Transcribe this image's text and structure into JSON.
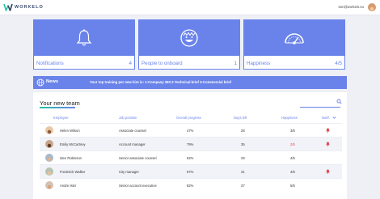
{
  "app": {
    "brand": "WORKELO",
    "user_email": "tom@workelo.eu"
  },
  "cards": [
    {
      "label": "Notifications",
      "count": "4",
      "icon": "bell-icon"
    },
    {
      "label": "People to onboard",
      "count": "1",
      "icon": "smiley-icon"
    },
    {
      "label": "Happiness",
      "count": "4/5",
      "icon": "gauge-icon"
    }
  ],
  "news": {
    "title": "News",
    "text": "Your top training per new hire is: 1-Company 360 2-Technical brief 3-Commercial brief"
  },
  "team": {
    "title": "Your new team",
    "columns": {
      "employee": "Employee",
      "job": "Job position",
      "progress": "Overall progress",
      "days": "Days left",
      "happiness": "Happiness",
      "notif": "Notif."
    },
    "rows": [
      {
        "name": "Helen Wilson",
        "job": "Associate counsel",
        "progress": "47%",
        "days": "28",
        "happiness": "3/5",
        "happiness_color": "#333333"
      },
      {
        "name": "Emily McCartney",
        "job": "Account manager",
        "progress": "79%",
        "days": "35",
        "happiness": "2/5",
        "happiness_color": "#e0474c"
      },
      {
        "name": "Iden Robinson",
        "job": "Senior associate counsel",
        "progress": "62%",
        "days": "29",
        "happiness": "4/5",
        "happiness_color": "#333333"
      },
      {
        "name": "Frederick Walker",
        "job": "City manager",
        "progress": "67%",
        "days": "31",
        "happiness": "4/5",
        "happiness_color": "#333333"
      },
      {
        "name": "Andre Isler",
        "job": "Senior account executive",
        "progress": "82%",
        "days": "37",
        "happiness": "5/5",
        "happiness_color": "#333333"
      }
    ]
  },
  "colors": {
    "accent": "#6a83ea",
    "alert": "#e0474c",
    "teal": "#24c1a3"
  }
}
